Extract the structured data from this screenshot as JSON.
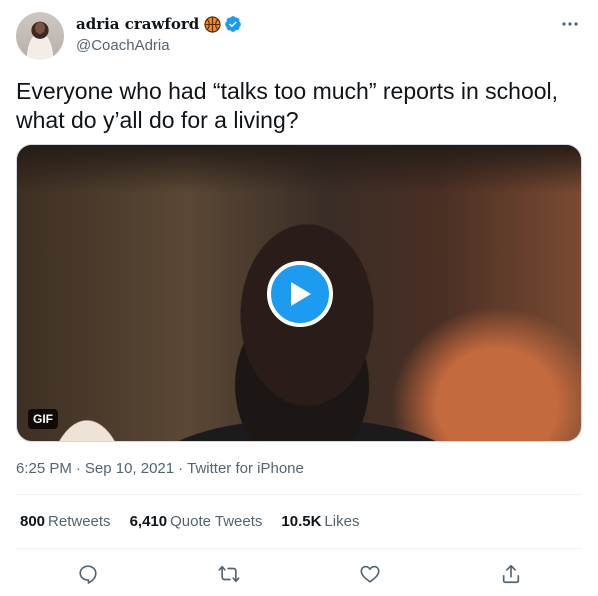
{
  "author": {
    "display_name": "adria crawford",
    "handle": "@CoachAdria",
    "badges": [
      "basketball-icon",
      "verified-icon"
    ]
  },
  "tweet": {
    "text": "Everyone who had “talks too much” reports in school, what do y’all do for a living?",
    "media_badge": "GIF"
  },
  "meta": {
    "time": "6:25 PM",
    "separator": "·",
    "date": "Sep 10, 2021",
    "source": "Twitter for iPhone"
  },
  "stats": [
    {
      "count": "800",
      "label": "Retweets"
    },
    {
      "count": "6,410",
      "label": "Quote Tweets"
    },
    {
      "count": "10.5K",
      "label": "Likes"
    }
  ],
  "actions": [
    "reply-icon",
    "retweet-icon",
    "like-icon",
    "share-icon"
  ],
  "colors": {
    "accent": "#1d9bf0",
    "text_primary": "#0f1419",
    "text_secondary": "#536471",
    "divider": "#eff3f4"
  }
}
